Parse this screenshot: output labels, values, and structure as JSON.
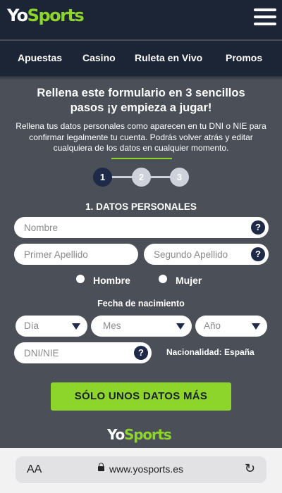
{
  "brand": {
    "yo": "Yo",
    "sports": "Sports"
  },
  "nav": {
    "items": [
      "Apuestas",
      "Casino",
      "Ruleta en Vivo",
      "Promos"
    ]
  },
  "form": {
    "title_line1": "Rellena este formulario en 3 sencillos",
    "title_line2": "pasos ¡y empieza a jugar!",
    "description": "Rellena tus datos personales como aparecen en tu DNI o NIE para confirmar legalmente tu cuenta. Podrás volver atrás y editar cualquiera de los datos en cualquier momento.",
    "steps": [
      "1",
      "2",
      "3"
    ],
    "current_step": 1,
    "section_title": "1. DATOS PERSONALES",
    "fields": {
      "nombre_placeholder": "Nombre",
      "apellido1_placeholder": "Primer Apellido",
      "apellido2_placeholder": "Segundo Apellido",
      "dni_placeholder": "DNI/NIE"
    },
    "help_symbol": "?",
    "gender": {
      "male": "Hombre",
      "female": "Mujer"
    },
    "dob": {
      "label": "Fecha de nacimiento",
      "day": "Día",
      "month": "Mes",
      "year": "Año"
    },
    "nationality": "Nacionalidad: España",
    "submit": "SÓLO UNOS DATOS MÁS"
  },
  "browser": {
    "text_size": "AA",
    "url": "www.yosports.es",
    "reload_icon": "↻"
  },
  "colors": {
    "brand_green": "#8dd52b",
    "header_bg": "#1c2536",
    "page_bg": "#4a4f58",
    "accent_navy": "#1f2a48"
  }
}
